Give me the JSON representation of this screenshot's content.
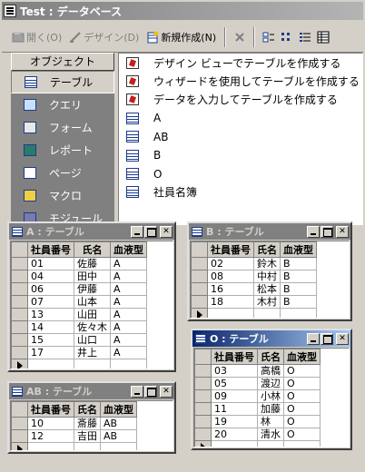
{
  "db_window": {
    "title": "Test : データベース",
    "toolbar": {
      "open_label": "開く(O)",
      "design_label": "デザイン(D)",
      "new_label": "新規作成(N)"
    },
    "objects_header": "オブジェクト",
    "objects": [
      {
        "label": "テーブル",
        "icon": "table-icon"
      },
      {
        "label": "クエリ",
        "icon": "query-icon"
      },
      {
        "label": "フォーム",
        "icon": "form-icon"
      },
      {
        "label": "レポート",
        "icon": "report-icon"
      },
      {
        "label": "ページ",
        "icon": "page-icon"
      },
      {
        "label": "マクロ",
        "icon": "macro-icon"
      },
      {
        "label": "モジュール",
        "icon": "module-icon"
      }
    ],
    "list_items": [
      {
        "label": "デザイン ビューでテーブルを作成する",
        "icon": "create-shortcut-icon"
      },
      {
        "label": "ウィザードを使用してテーブルを作成する",
        "icon": "create-shortcut-icon"
      },
      {
        "label": "データを入力してテーブルを作成する",
        "icon": "create-shortcut-icon"
      },
      {
        "label": "A",
        "icon": "table-icon"
      },
      {
        "label": "AB",
        "icon": "table-icon"
      },
      {
        "label": "B",
        "icon": "table-icon"
      },
      {
        "label": "O",
        "icon": "table-icon"
      },
      {
        "label": "社員名簿",
        "icon": "table-icon"
      }
    ]
  },
  "tables": {
    "A": {
      "title": "A : テーブル",
      "headers": [
        "社員番号",
        "氏名",
        "血液型"
      ],
      "rows": [
        [
          "01",
          "佐藤",
          "A"
        ],
        [
          "04",
          "田中",
          "A"
        ],
        [
          "06",
          "伊藤",
          "A"
        ],
        [
          "07",
          "山本",
          "A"
        ],
        [
          "13",
          "山田",
          "A"
        ],
        [
          "14",
          "佐々木",
          "A"
        ],
        [
          "15",
          "山口",
          "A"
        ],
        [
          "17",
          "井上",
          "A"
        ]
      ]
    },
    "B": {
      "title": "B : テーブル",
      "headers": [
        "社員番号",
        "氏名",
        "血液型"
      ],
      "rows": [
        [
          "02",
          "鈴木",
          "B"
        ],
        [
          "08",
          "中村",
          "B"
        ],
        [
          "16",
          "松本",
          "B"
        ],
        [
          "18",
          "木村",
          "B"
        ]
      ]
    },
    "O": {
      "title": "O : テーブル",
      "headers": [
        "社員番号",
        "氏名",
        "血液型"
      ],
      "rows": [
        [
          "03",
          "高橋",
          "O"
        ],
        [
          "05",
          "渡辺",
          "O"
        ],
        [
          "09",
          "小林",
          "O"
        ],
        [
          "11",
          "加藤",
          "O"
        ],
        [
          "19",
          "林",
          "O"
        ],
        [
          "20",
          "清水",
          "O"
        ]
      ]
    },
    "AB": {
      "title": "AB : テーブル",
      "headers": [
        "社員番号",
        "氏名",
        "血液型"
      ],
      "rows": [
        [
          "10",
          "斎藤",
          "AB"
        ],
        [
          "12",
          "吉田",
          "AB"
        ]
      ]
    }
  }
}
